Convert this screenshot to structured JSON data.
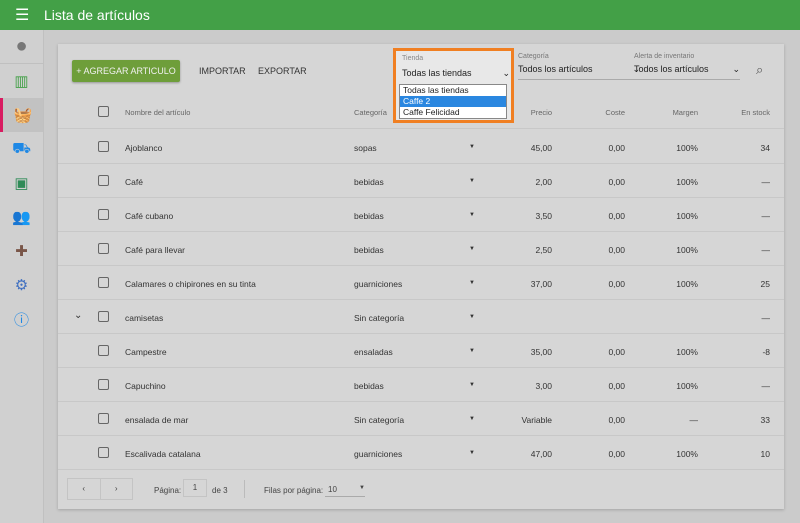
{
  "header": {
    "title": "Lista de artículos"
  },
  "sidebar": {
    "items": [
      "account",
      "reports",
      "items",
      "inventory",
      "customers",
      "employees",
      "integrations",
      "settings",
      "help"
    ]
  },
  "toolbar": {
    "add": "+ AGREGAR ARTICULO",
    "import": "IMPORTAR",
    "export": "EXPORTAR"
  },
  "filters": {
    "tienda": {
      "label": "Tienda",
      "value": "Todas las tiendas",
      "options": [
        "Todas las tiendas",
        "Caffe 2",
        "Caffe Felicidad"
      ],
      "highlighted": "Caffe 2"
    },
    "categoria": {
      "label": "Categoría",
      "value": "Todos los artículos"
    },
    "alerta": {
      "label": "Alerta de inventario",
      "value": "Todos los artículos"
    }
  },
  "table": {
    "headers": {
      "name": "Nombre del artículo",
      "category": "Categoría",
      "price": "Precio",
      "cost": "Coste",
      "margin": "Margen",
      "stock": "En stock"
    },
    "rows": [
      {
        "name": "Ajoblanco",
        "category": "sopas",
        "price": "45,00",
        "cost": "0,00",
        "margin": "100%",
        "stock": "34"
      },
      {
        "name": "Café",
        "category": "bebidas",
        "price": "2,00",
        "cost": "0,00",
        "margin": "100%",
        "stock": "—"
      },
      {
        "name": "Café cubano",
        "category": "bebidas",
        "price": "3,50",
        "cost": "0,00",
        "margin": "100%",
        "stock": "—"
      },
      {
        "name": "Café para llevar",
        "category": "bebidas",
        "price": "2,50",
        "cost": "0,00",
        "margin": "100%",
        "stock": "—"
      },
      {
        "name": "Calamares o chipirones en su tinta",
        "category": "guarniciones",
        "price": "37,00",
        "cost": "0,00",
        "margin": "100%",
        "stock": "25"
      },
      {
        "name": "camisetas",
        "category": "Sin categoría",
        "price": "",
        "cost": "",
        "margin": "",
        "stock": "—",
        "expandable": true
      },
      {
        "name": "Campestre",
        "category": "ensaladas",
        "price": "35,00",
        "cost": "0,00",
        "margin": "100%",
        "stock": "-8"
      },
      {
        "name": "Capuchino",
        "category": "bebidas",
        "price": "3,00",
        "cost": "0,00",
        "margin": "100%",
        "stock": "—"
      },
      {
        "name": "ensalada de mar",
        "category": "Sin categoría",
        "price": "Variable",
        "cost": "0,00",
        "margin": "—",
        "stock": "33"
      },
      {
        "name": "Escalivada catalana",
        "category": "guarniciones",
        "price": "47,00",
        "cost": "0,00",
        "margin": "100%",
        "stock": "10"
      }
    ]
  },
  "pagination": {
    "page_label": "Página:",
    "page": "1",
    "of": "de 3",
    "rows_label": "Filas por página:",
    "rows": "10"
  },
  "colors": {
    "header": "#43a047",
    "accent": "#d81b60",
    "highlight": "#f07f22"
  }
}
